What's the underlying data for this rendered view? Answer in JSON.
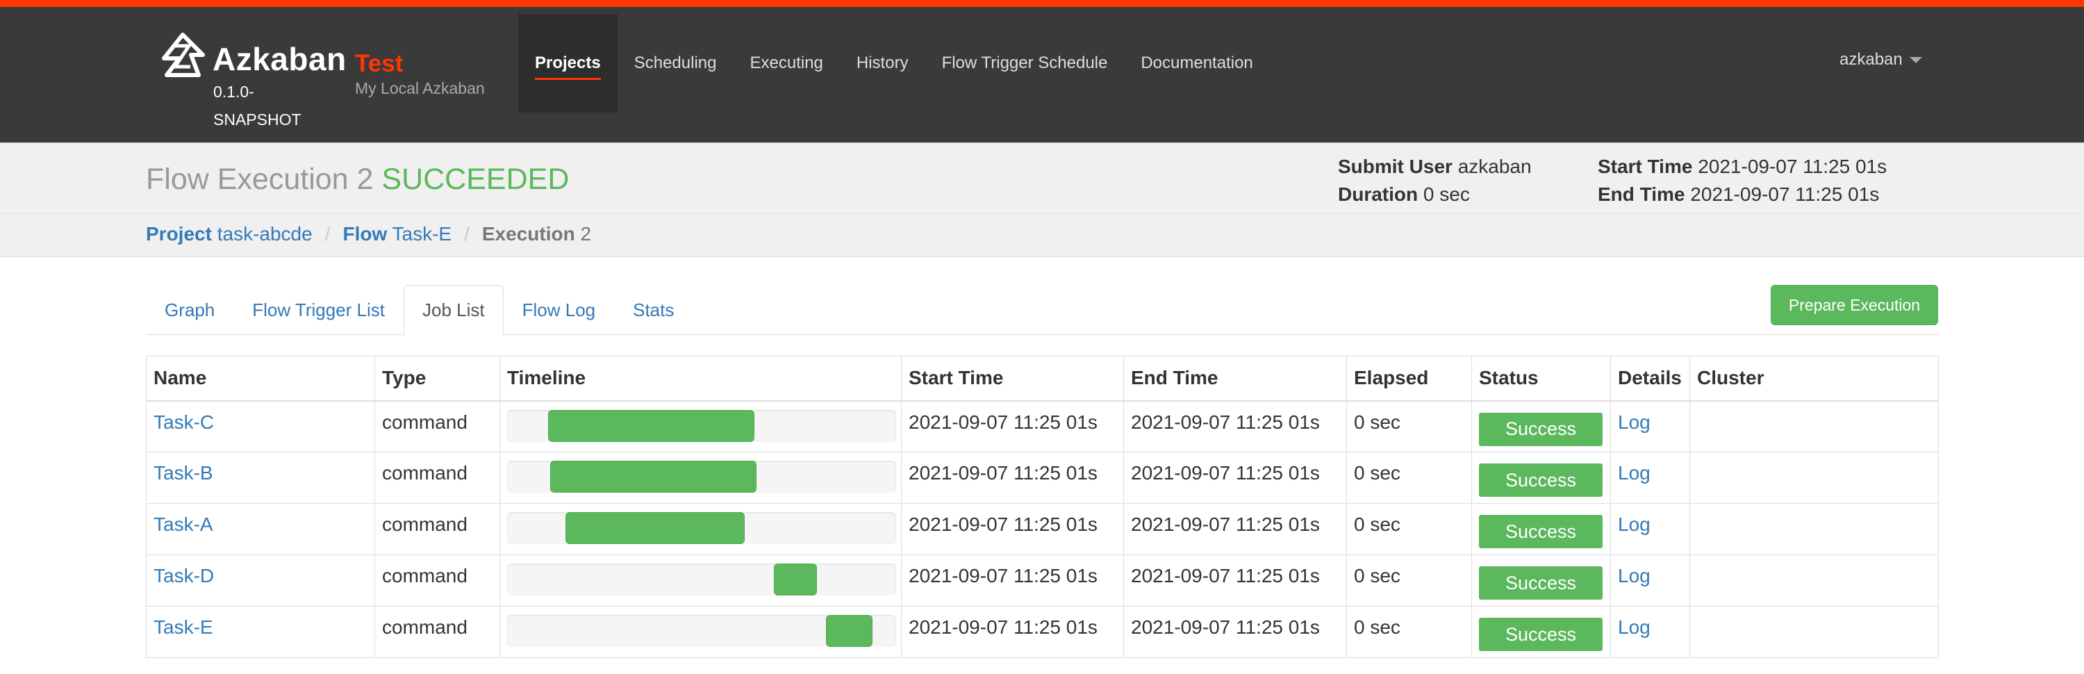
{
  "navbar": {
    "brand_name": "Azkaban",
    "brand_version": "0.1.0-SNAPSHOT",
    "env_name": "Test",
    "env_description": "My Local Azkaban",
    "items": [
      {
        "label": "Projects",
        "active": true
      },
      {
        "label": "Scheduling",
        "active": false
      },
      {
        "label": "Executing",
        "active": false
      },
      {
        "label": "History",
        "active": false
      },
      {
        "label": "Flow Trigger Schedule",
        "active": false
      },
      {
        "label": "Documentation",
        "active": false
      }
    ],
    "user": "azkaban"
  },
  "header": {
    "title": "Flow Execution 2",
    "status": "SUCCEEDED",
    "submit_user_label": "Submit User",
    "submit_user": "azkaban",
    "duration_label": "Duration",
    "duration": "0 sec",
    "start_time_label": "Start Time",
    "start_time": "2021-09-07 11:25 01s",
    "end_time_label": "End Time",
    "end_time": "2021-09-07 11:25 01s"
  },
  "breadcrumb": {
    "project_label": "Project",
    "project": "task-abcde",
    "flow_label": "Flow",
    "flow": "Task-E",
    "execution_label": "Execution",
    "execution": "2"
  },
  "tabs": [
    {
      "label": "Graph",
      "active": false
    },
    {
      "label": "Flow Trigger List",
      "active": false
    },
    {
      "label": "Job List",
      "active": true
    },
    {
      "label": "Flow Log",
      "active": false
    },
    {
      "label": "Stats",
      "active": false
    }
  ],
  "prepare_button": "Prepare Execution",
  "table": {
    "headers": [
      "Name",
      "Type",
      "Timeline",
      "Start Time",
      "End Time",
      "Elapsed",
      "Status",
      "Details",
      "Cluster"
    ],
    "rows": [
      {
        "name": "Task-C",
        "type": "command",
        "timeline_start": 0.105,
        "timeline_end": 0.635,
        "start": "2021-09-07 11:25 01s",
        "end": "2021-09-07 11:25 01s",
        "elapsed": "0 sec",
        "status": "Success",
        "details": "Log",
        "cluster": ""
      },
      {
        "name": "Task-B",
        "type": "command",
        "timeline_start": 0.11,
        "timeline_end": 0.64,
        "start": "2021-09-07 11:25 01s",
        "end": "2021-09-07 11:25 01s",
        "elapsed": "0 sec",
        "status": "Success",
        "details": "Log",
        "cluster": ""
      },
      {
        "name": "Task-A",
        "type": "command",
        "timeline_start": 0.15,
        "timeline_end": 0.61,
        "start": "2021-09-07 11:25 01s",
        "end": "2021-09-07 11:25 01s",
        "elapsed": "0 sec",
        "status": "Success",
        "details": "Log",
        "cluster": ""
      },
      {
        "name": "Task-D",
        "type": "command",
        "timeline_start": 0.685,
        "timeline_end": 0.795,
        "start": "2021-09-07 11:25 01s",
        "end": "2021-09-07 11:25 01s",
        "elapsed": "0 sec",
        "status": "Success",
        "details": "Log",
        "cluster": ""
      },
      {
        "name": "Task-E",
        "type": "command",
        "timeline_start": 0.82,
        "timeline_end": 0.94,
        "start": "2021-09-07 11:25 01s",
        "end": "2021-09-07 11:25 01s",
        "elapsed": "0 sec",
        "status": "Success",
        "details": "Log",
        "cluster": ""
      }
    ]
  },
  "colors": {
    "accent": "#ff3601",
    "success": "#5cb85c",
    "link": "#337ab7",
    "navbar_bg": "#3a3a3a"
  },
  "icons": {
    "brand": "azkaban-logo-icon",
    "user_menu": "caret-down-icon"
  }
}
